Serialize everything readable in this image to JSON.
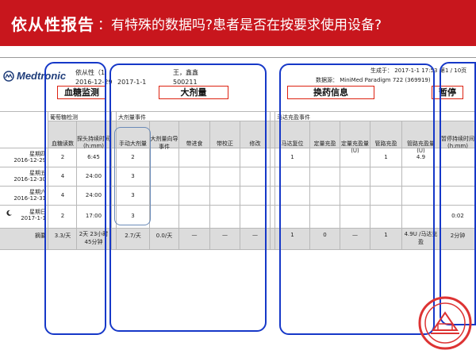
{
  "banner": {
    "title": "依从性报告",
    "subtitle": "：有特殊的数据吗?患者是否在按要求使用设备?"
  },
  "report": {
    "logo": "Medtronic",
    "report_name": "依从性（1",
    "patient": "王，鑫鑫",
    "patient_id": "500211",
    "date_from": "2016-12-29",
    "date_to": "2017-1-1",
    "generated": "生成于： 2017-1-1 17:53",
    "page": "第1 / 10页",
    "source": "数据源： MiniMed Paradigm 722 (369919)"
  },
  "annotations": {
    "bg": "血糖监测",
    "bolus": "大剂量",
    "refill": "换药信息",
    "suspend": "暂停"
  },
  "sections": {
    "bg": "葡萄糖检测",
    "bolus": "大剂量事件",
    "refill": "马达充盈事件"
  },
  "columns": {
    "bg_count": "血糖读数",
    "sensor_duration": "探头持续时间 (h:mm)",
    "manual_bolus": "手动大剂量",
    "wizard_bolus": "大剂量向导事件",
    "with_food": "带进食",
    "with_correction": "带校正",
    "modified": "修改",
    "motor_reset": "马达复位",
    "fixed_prime": "定量充盈",
    "fixed_prime_u": "定量充盈量 (U)",
    "tubing_prime": "管路充盈",
    "tubing_prime_u": "管路充盈量 (U)",
    "suspend_duration": "暂停持续时间 (h:mm)"
  },
  "rows": [
    {
      "day": "星期四",
      "date": "2016-12-29",
      "bg": "2",
      "sensor": "6:45",
      "manual": "2",
      "motor": "1",
      "tubing": "1",
      "tubing_u": "4.9",
      "suspend": ""
    },
    {
      "day": "星期五",
      "date": "2016-12-30",
      "bg": "4",
      "sensor": "24:00",
      "manual": "3",
      "motor": "",
      "tubing": "",
      "tubing_u": "",
      "suspend": ""
    },
    {
      "day": "星期六",
      "date": "2016-12-31",
      "bg": "4",
      "sensor": "24:00",
      "manual": "3",
      "motor": "",
      "tubing": "",
      "tubing_u": "",
      "suspend": ""
    },
    {
      "day": "星期日",
      "date": "2017-1-1",
      "bg": "2",
      "sensor": "17:00",
      "manual": "3",
      "motor": "",
      "tubing": "",
      "tubing_u": "",
      "suspend": "0:02"
    }
  ],
  "summary": {
    "label": "摘要",
    "bg": "3.3/天",
    "sensor": "2天 23小时 45分钟",
    "manual": "2.7/天",
    "wizard": "0.0/天",
    "with_food": "—",
    "with_correction": "—",
    "modified": "—",
    "motor": "1",
    "fixed": "0",
    "fixed_u": "—",
    "tubing": "1",
    "tubing_u": "4.9U /马达充盈",
    "suspend": "2分钟"
  },
  "colors": {
    "banner": "#c8161d",
    "annotation_border": "#1638c8",
    "label_border": "#dd2211"
  }
}
